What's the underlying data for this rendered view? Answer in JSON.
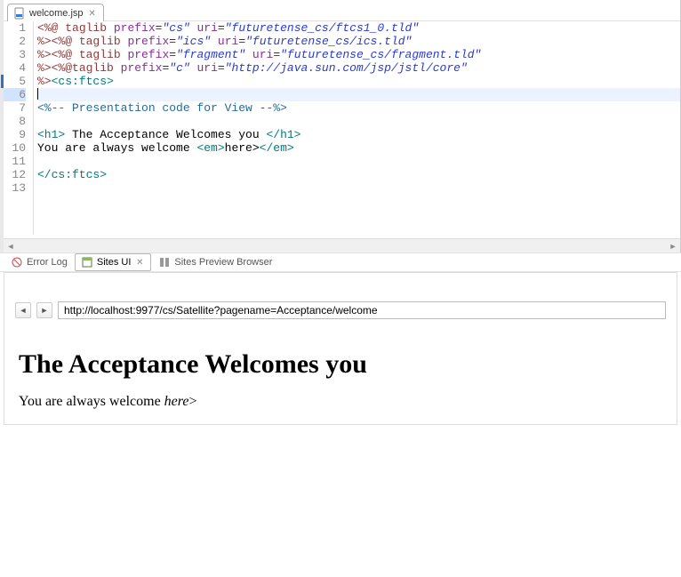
{
  "editor": {
    "tab_label": "welcome.jsp",
    "lines": [
      {
        "n": 1,
        "html": "<span class='dir'>&lt;%@</span> <span class='dir'>taglib</span> <span class='attr-name'>prefix</span>=<span class='attr-val'>\"cs\"</span> <span class='attr-name'>uri</span>=<span class='attr-val'>\"futuretense_cs/ftcs1_0.tld\"</span>"
      },
      {
        "n": 2,
        "html": "<span class='dir'>%&gt;&lt;%@</span> <span class='dir'>taglib</span> <span class='attr-name'>prefix</span>=<span class='attr-val'>\"ics\"</span> <span class='attr-name'>uri</span>=<span class='attr-val'>\"futuretense_cs/ics.tld\"</span>"
      },
      {
        "n": 3,
        "html": "<span class='dir'>%&gt;&lt;%@</span> <span class='dir'>taglib</span> <span class='attr-name'>prefix</span>=<span class='attr-val'>\"fragment\"</span> <span class='attr-name'>uri</span>=<span class='attr-val'>\"futuretense_cs/fragment.tld\"</span>"
      },
      {
        "n": 4,
        "html": "<span class='dir'>%&gt;&lt;%@</span><span class='dir'>taglib</span> <span class='attr-name'>prefix</span>=<span class='attr-val'>\"c\"</span> <span class='attr-name'>uri</span>=<span class='attr-val'>\"http://java.sun.com/jsp/jstl/core\"</span>"
      },
      {
        "n": 5,
        "html": "<span class='dir'>%&gt;</span><span class='tag'>&lt;cs:ftcs&gt;</span>",
        "marker": true
      },
      {
        "n": 6,
        "html": "<span class='cursor-bar'></span>",
        "hl": true
      },
      {
        "n": 7,
        "html": "<span class='comment'>&lt;%-- Presentation code for View --%&gt;</span>"
      },
      {
        "n": 8,
        "html": ""
      },
      {
        "n": 9,
        "html": "<span class='tag'>&lt;h1&gt;</span><span class='plain'> The Acceptance Welcomes you </span><span class='tag'>&lt;/h1&gt;</span>"
      },
      {
        "n": 10,
        "html": "<span class='plain'>You are always welcome </span><span class='tag'>&lt;em&gt;</span><span class='plain'>here&gt;</span><span class='tag'>&lt;/em&gt;</span>"
      },
      {
        "n": 11,
        "html": ""
      },
      {
        "n": 12,
        "html": "<span class='tag'>&lt;/cs:ftcs&gt;</span>"
      },
      {
        "n": 13,
        "html": ""
      }
    ]
  },
  "views": {
    "error_log": "Error Log",
    "sites_ui": "Sites UI",
    "sites_preview": "Sites Preview Browser"
  },
  "browser": {
    "url": "http://localhost:9977/cs/Satellite?pagename=Acceptance/welcome"
  },
  "preview": {
    "heading": "The Acceptance Welcomes you",
    "paragraph_prefix": "You are always welcome ",
    "paragraph_em": "here",
    "paragraph_suffix": ">"
  }
}
